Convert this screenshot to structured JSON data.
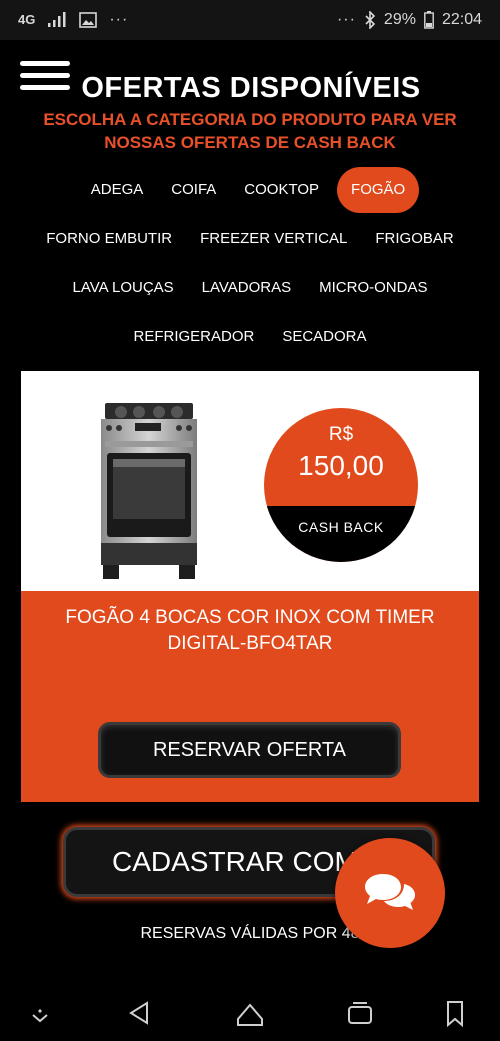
{
  "status_bar": {
    "network": "4G",
    "battery": "29%",
    "time": "22:04",
    "dots_left": "···",
    "dots_right": "···"
  },
  "header": {
    "menu_icon": "hamburger-menu-icon",
    "title": "OFERTAS DISPONÍVEIS",
    "subtitle": "ESCOLHA A CATEGORIA DO PRODUTO PARA VER NOSSAS OFERTAS DE CASH BACK"
  },
  "categories": {
    "rows": [
      [
        {
          "label": "ADEGA"
        },
        {
          "label": "COIFA"
        },
        {
          "label": "COOKTOP"
        },
        {
          "label": "FOGÃO",
          "active": true
        }
      ],
      [
        {
          "label": "FORNO EMBUTIR"
        },
        {
          "label": "FREEZER VERTICAL"
        },
        {
          "label": "FRIGOBAR"
        }
      ],
      [
        {
          "label": "LAVA LOUÇAS"
        },
        {
          "label": "LAVADORAS"
        },
        {
          "label": "MICRO-ONDAS"
        }
      ],
      [
        {
          "label": "REFRIGERADOR"
        },
        {
          "label": "SECADORA"
        }
      ]
    ]
  },
  "product": {
    "image_icon": "stove-product-image",
    "currency": "R$",
    "cashback_value": "150,00",
    "cashback_label": "CASH BACK",
    "name": "FOGÃO 4 BOCAS COR INOX COM TIMER DIGITAL-BFO4TAR",
    "reserve_label": "RESERVAR OFERTA"
  },
  "register": {
    "label": "CADASTRAR COMP"
  },
  "footer_note": "RESERVAS VÁLIDAS POR 48",
  "chat_button": {
    "icon": "chat-bubbles-icon"
  },
  "colors": {
    "accent": "#e04a1c",
    "background": "#000000",
    "card": "#ffffff"
  },
  "nav_bar": {
    "icons": [
      "collapse-icon",
      "back-icon",
      "home-icon",
      "recents-icon",
      "bookmark-icon"
    ]
  }
}
